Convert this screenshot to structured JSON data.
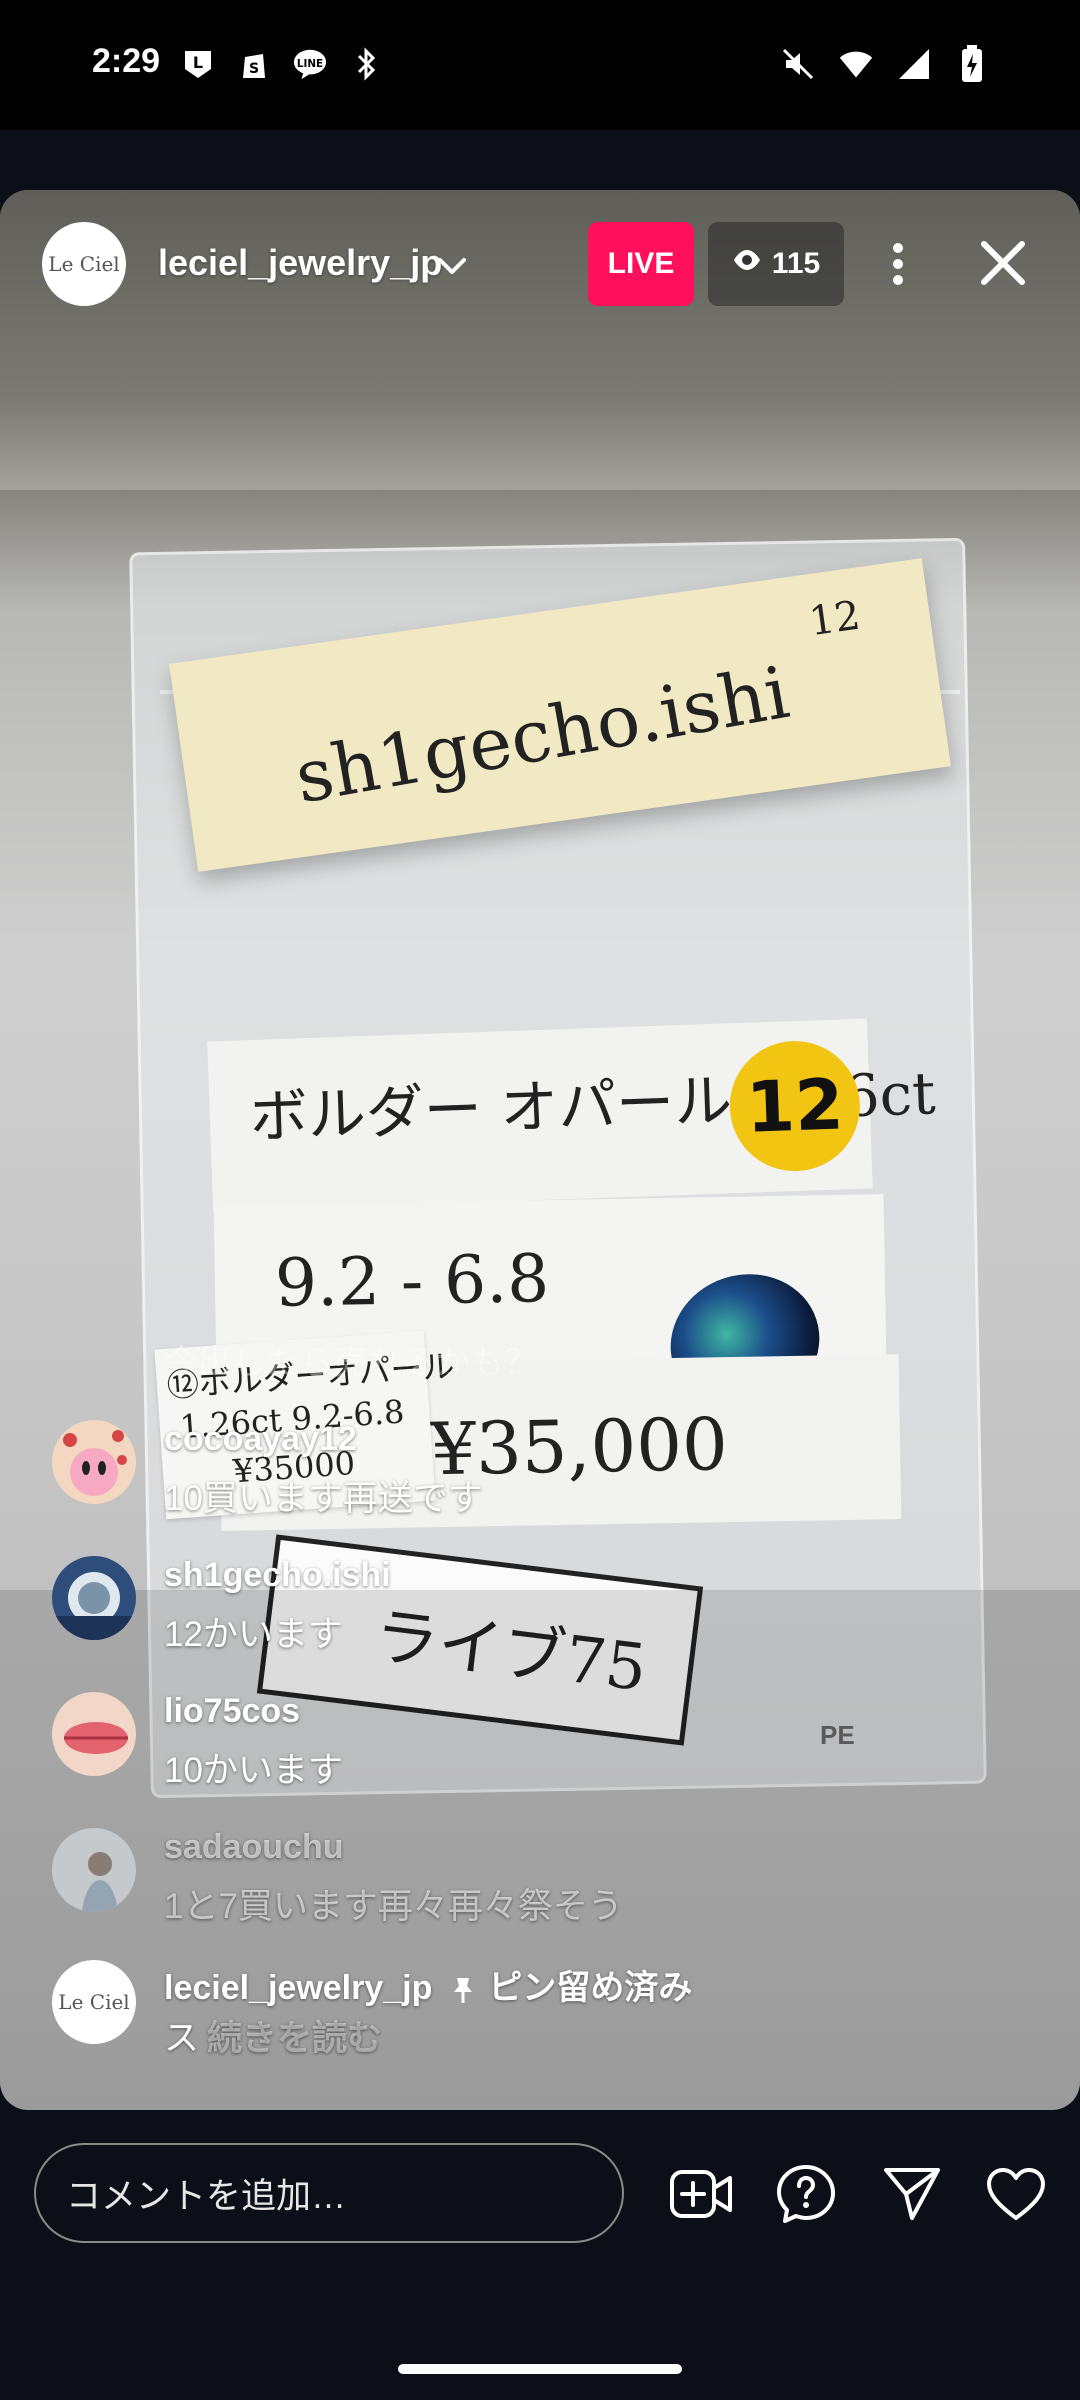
{
  "status_bar": {
    "time": "2:29",
    "left_icons": [
      "l-app-icon",
      "shopify-icon",
      "line-icon",
      "bluetooth-icon"
    ],
    "right_icons": [
      "mute-icon",
      "wifi-icon",
      "signal-icon",
      "battery-charging-icon"
    ]
  },
  "header": {
    "avatar_text": "Le Ciel",
    "username": "leciel_jewelry_jp",
    "live_label": "LIVE",
    "viewer_count": "115"
  },
  "video": {
    "note_name": "sh1gecho.ishi",
    "note_number": "12",
    "card1_text": "ボルダー オパール 1.26ct",
    "tag_number": "12",
    "card2_text": "9.2 - 6.8",
    "card3_text": "¥35,000",
    "small_label": {
      "line1": "⑫ボルダーオパール",
      "line2": "1.26ct 9.2-6.8",
      "line3": "¥35000"
    },
    "live_box_text": "ライブ75",
    "recycle_mark": "PE"
  },
  "comments": {
    "faded_top": "今出したら売れるかも？",
    "items": [
      {
        "user": "cocoayay12",
        "text": "10買います再送です",
        "faded": false
      },
      {
        "user": "sh1gecho.ishi",
        "text": "12かいます",
        "faded": false
      },
      {
        "user": "lio75cos",
        "text": "10かいます",
        "faded": false
      },
      {
        "user": "sadaouchu",
        "text": "1と7買います再々再々祭そう",
        "faded": true
      }
    ],
    "pinned": {
      "avatar_text": "Le Ciel",
      "user": "leciel_jewelry_jp",
      "pinned_label": "ピン留め済み",
      "text": "ス",
      "read_more": "続きを読む"
    }
  },
  "bottom_bar": {
    "comment_placeholder": "コメントを追加…"
  }
}
